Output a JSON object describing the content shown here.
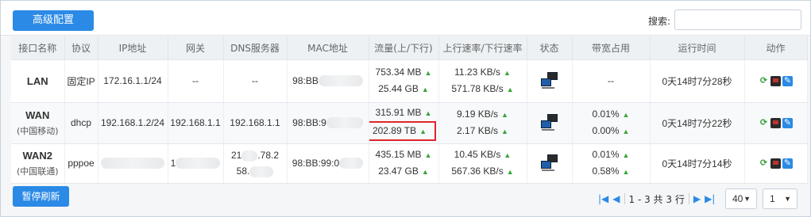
{
  "toolbar": {
    "advanced_label": "高级配置",
    "search_label": "搜索:",
    "search_value": ""
  },
  "columns": [
    "接口名称",
    "协议",
    "IP地址",
    "网关",
    "DNS服务器",
    "MAC地址",
    "流量(上/下行)",
    "上行速率/下行速率",
    "状态",
    "带宽占用",
    "运行时间",
    "动作"
  ],
  "rows": [
    {
      "name": "LAN",
      "isp": "",
      "protocol": "固定IP",
      "ip": "172.16.1.1/24",
      "gateway": "--",
      "dns": "--",
      "mac": "98:BB",
      "traffic_up": "753.34 MB",
      "traffic_down": "25.44 GB",
      "rate_up": "11.23 KB/s",
      "rate_down": "571.78 KB/s",
      "bw_up": "",
      "bw_down": "--",
      "uptime": "0天14时7分28秒"
    },
    {
      "name": "WAN",
      "isp": "(中国移动)",
      "protocol": "dhcp",
      "ip": "192.168.1.2/24",
      "gateway": "192.168.1.1",
      "dns": "192.168.1.1",
      "mac": "98:BB:9",
      "traffic_up": "315.91 MB",
      "traffic_down": "202.89 TB",
      "rate_up": "9.19 KB/s",
      "rate_down": "2.17 KB/s",
      "bw_up": "0.01%",
      "bw_down": "0.00%",
      "uptime": "0天14时7分22秒"
    },
    {
      "name": "WAN2",
      "isp": "(中国联通)",
      "protocol": "pppoe",
      "ip": "",
      "gateway": "1",
      "dns_line1": "21",
      "dns_line1b": ".78.2",
      "dns_line2": "58.",
      "mac": "98:BB:99:0",
      "traffic_up": "435.15 MB",
      "traffic_down": "23.47 GB",
      "rate_up": "10.45 KB/s",
      "rate_down": "567.36 KB/s",
      "bw_up": "0.01%",
      "bw_down": "0.58%",
      "uptime": "0天14时7分14秒"
    }
  ],
  "footer": {
    "pause_label": "暂停刷新",
    "page_info": "1 - 3 共 3 行",
    "page_size": "40",
    "page_number": "1"
  },
  "colors": {
    "accent": "#2b8ae6",
    "highlight_box": "#e0252b",
    "up_arrow": "#3aa33a"
  }
}
